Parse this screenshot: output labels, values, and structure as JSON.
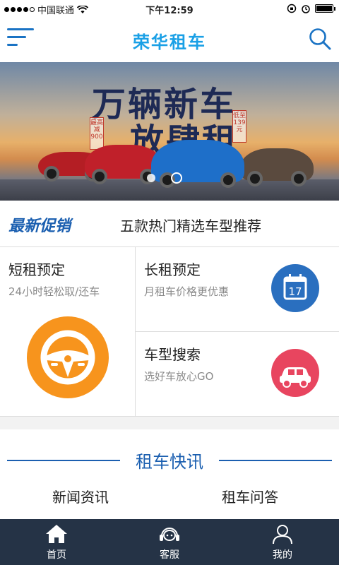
{
  "status_bar": {
    "carrier": "中国联通",
    "time": "下午12:59"
  },
  "header": {
    "title": "荣华租车"
  },
  "banner": {
    "headline_line1": "万辆新车",
    "headline_line2": "放肆租",
    "badge_left": "最高减900",
    "badge_right": "低至139元",
    "page_count": 2,
    "active_page": 2
  },
  "promo": {
    "tag": "最新促销",
    "text": "五款热门精选车型推荐"
  },
  "services": {
    "short_rent": {
      "title": "短租预定",
      "subtitle": "24小时轻松取/还车",
      "icon": "steering-wheel-icon",
      "color": "#f7941d"
    },
    "long_rent": {
      "title": "长租预定",
      "subtitle": "月租车价格更优惠",
      "icon": "calendar-icon",
      "color": "#2a6fbf",
      "calendar_day": "17"
    },
    "car_search": {
      "title": "车型搜索",
      "subtitle": "选好车放心GO",
      "icon": "car-icon",
      "color": "#e8455f"
    }
  },
  "news": {
    "title": "租车快讯",
    "links": [
      "新闻资讯",
      "租车问答"
    ]
  },
  "tabbar": {
    "tabs": [
      {
        "label": "首页",
        "icon": "home-icon",
        "active": true
      },
      {
        "label": "客服",
        "icon": "headset-icon",
        "active": false
      },
      {
        "label": "我的",
        "icon": "user-icon",
        "active": false
      }
    ]
  },
  "colors": {
    "brand": "#1aa0e6",
    "accent_blue": "#1b5fb0",
    "tabbar_bg": "#253346"
  }
}
